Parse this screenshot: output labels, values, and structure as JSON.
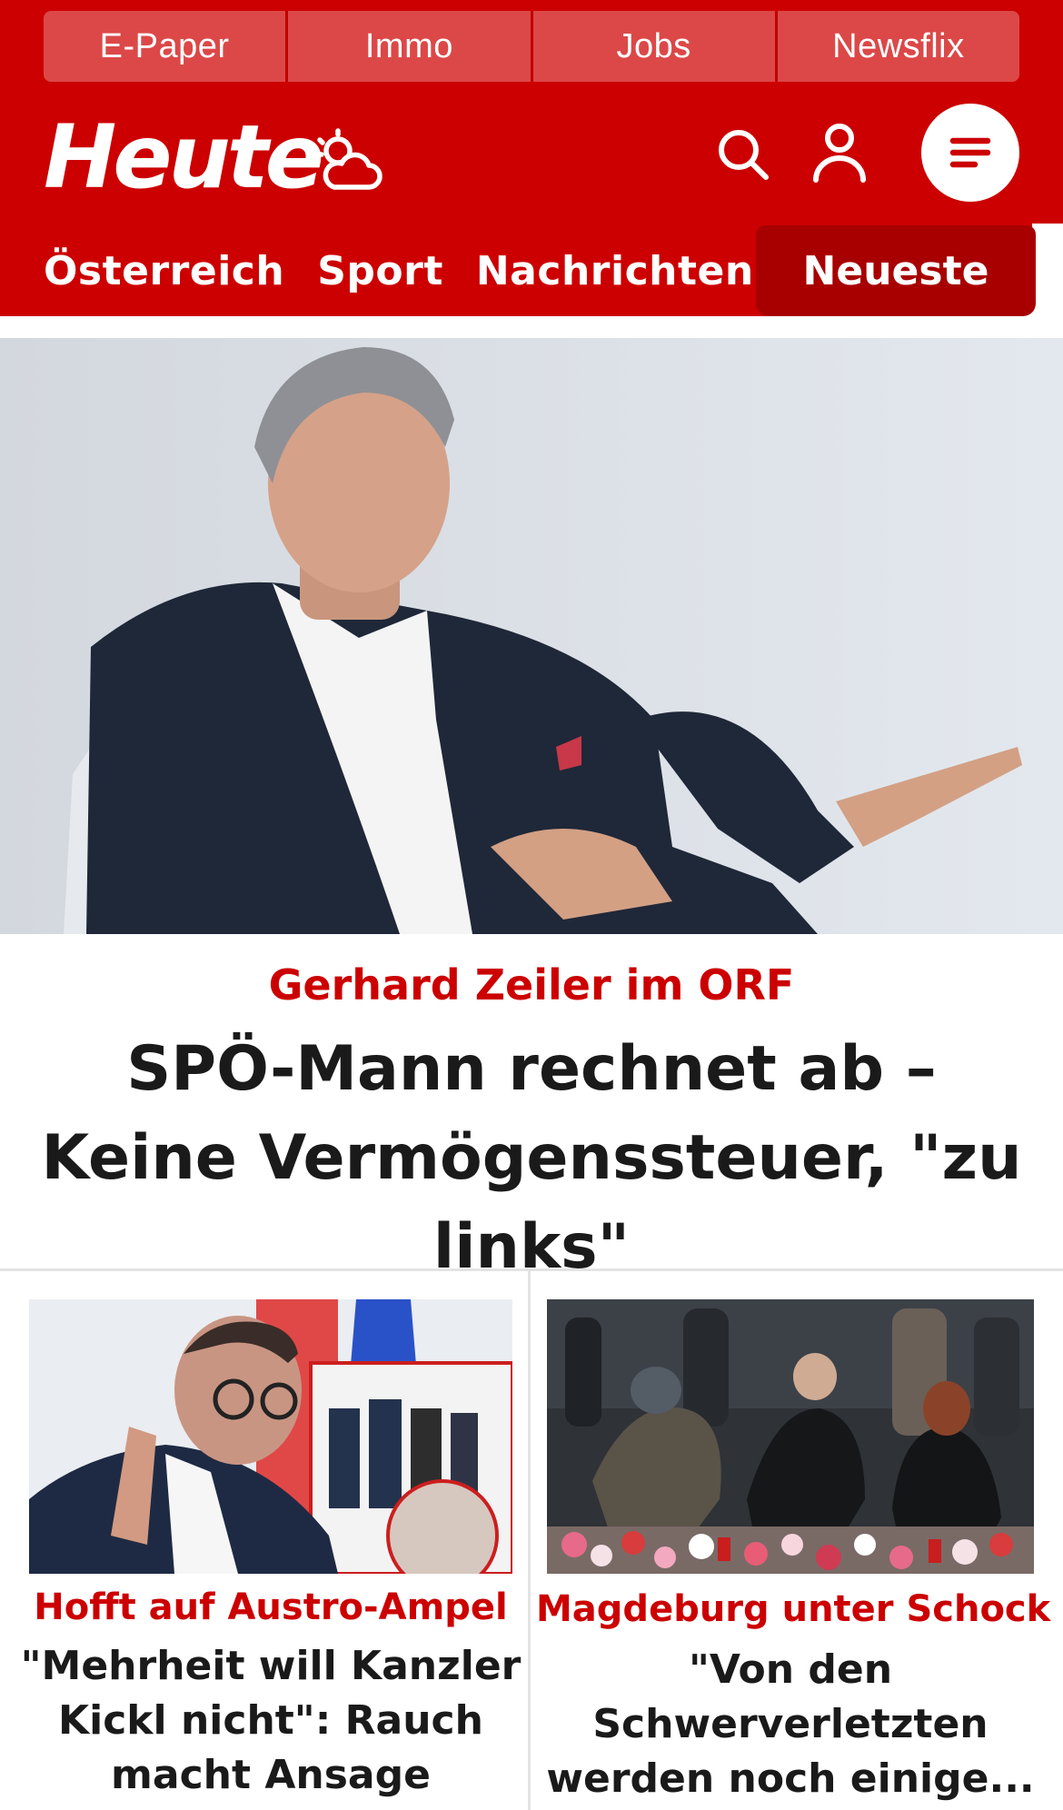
{
  "top_links": [
    "E-Paper",
    "Immo",
    "Jobs",
    "Newsflix"
  ],
  "header": {
    "logo_text": "Heute",
    "brand_color": "#cc0000",
    "icons": [
      "weather-icon",
      "search-icon",
      "user-icon",
      "menu-icon"
    ]
  },
  "nav": {
    "items": [
      "Österreich",
      "Sport",
      "Nachrichten"
    ],
    "active_label": "Neueste"
  },
  "hero": {
    "kicker": "Gerhard Zeiler im ORF",
    "title": "SPÖ-Mann rechnet ab – Keine Vermögenssteuer, \"zu links\""
  },
  "cards": [
    {
      "kicker": "Hofft auf Austro-Ampel",
      "title": "\"Mehrheit will Kanzler Kickl nicht\": Rauch macht Ansage"
    },
    {
      "kicker": "Magdeburg unter Schock",
      "title": "\"Von den Schwerverletzten werden noch einige..."
    }
  ]
}
